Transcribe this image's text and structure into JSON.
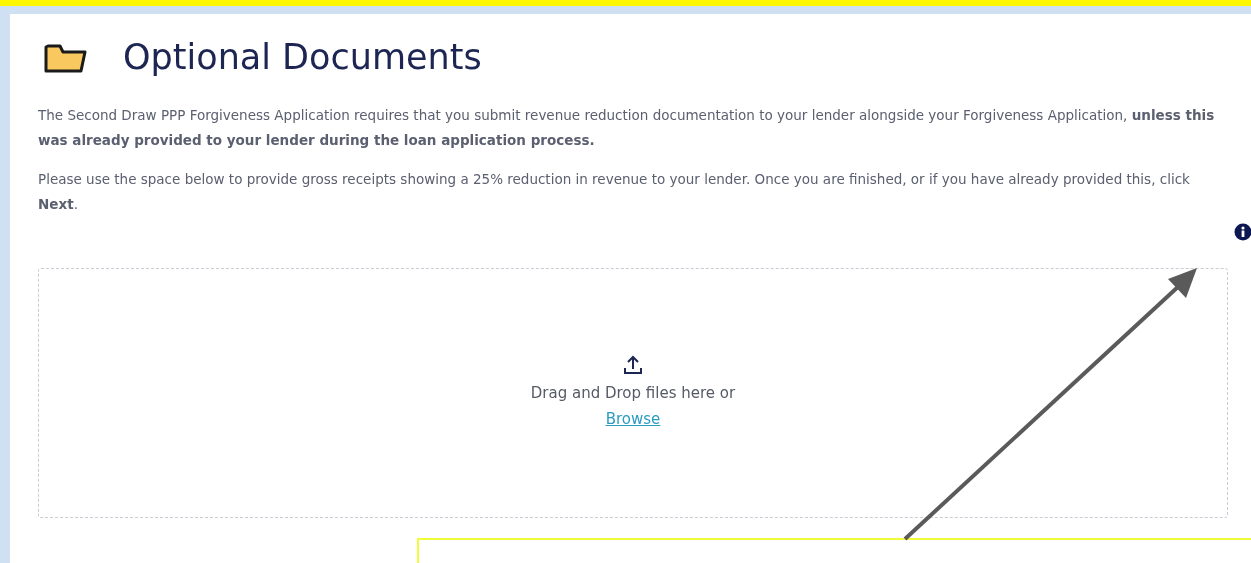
{
  "heading": "Optional Documents",
  "paragraphs": [
    "The Second Draw PPP Forgiveness Application requires that you submit revenue reduction documentation to your lender alongside your Forgiveness Application, **unless this was already provided to your lender during the loan application process.**",
    "Please use the space below to provide gross receipts showing a 25% reduction in revenue to your lender. Once you are finished, or if you have already provided this, click **Next**."
  ],
  "dropzone": {
    "prompt": "Drag and Drop files here or",
    "link": "Browse"
  }
}
